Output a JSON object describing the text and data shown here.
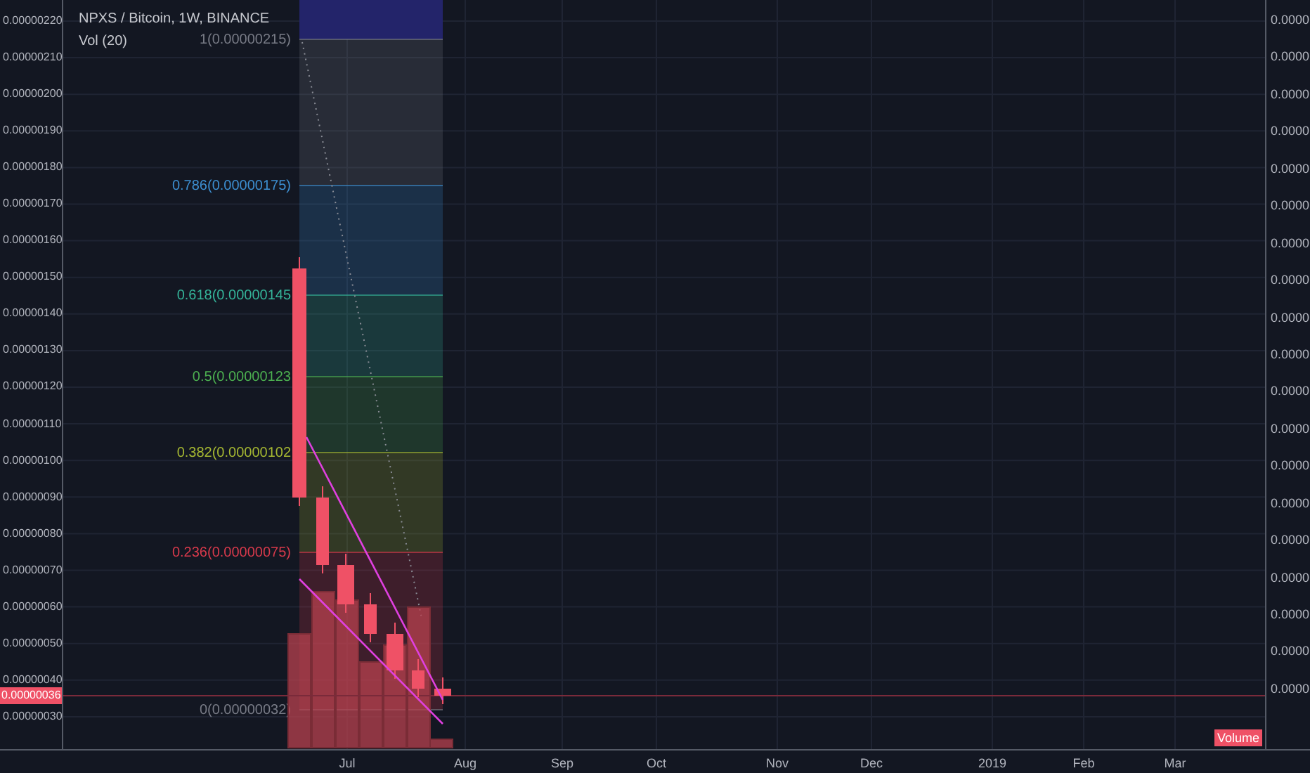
{
  "legend": {
    "symbol": "NPXS / Bitcoin, 1W, BINANCE",
    "indicator": "Vol (20)"
  },
  "price_axis": [
    "0.00000220",
    "0.00000210",
    "0.00000200",
    "0.00000190",
    "0.00000180",
    "0.00000170",
    "0.00000160",
    "0.00000150",
    "0.00000140",
    "0.00000130",
    "0.00000120",
    "0.00000110",
    "0.00000100",
    "0.00000090",
    "0.00000080",
    "0.00000070",
    "0.00000060",
    "0.00000050",
    "0.00000040",
    "0.00000030"
  ],
  "current_price": "0.00000036",
  "volume_axis": [
    "0.0000",
    "0.0000",
    "0.0000",
    "0.0000",
    "0.0000",
    "0.0000",
    "0.0000",
    "0.0000",
    "0.0000",
    "0.0000",
    "0.0000",
    "0.0000",
    "0.0000",
    "0.0000",
    "0.0000",
    "0.0000",
    "0.0000",
    "0.0000",
    "0.0000"
  ],
  "volume_badge": "Volume",
  "time_axis": [
    "Jul",
    "Aug",
    "Sep",
    "Oct",
    "Nov",
    "Dec",
    "2019",
    "Feb",
    "Mar"
  ],
  "fib_levels": [
    {
      "label": "1(0.00000215)",
      "color": "#787b86"
    },
    {
      "label": "0.786(0.00000175)",
      "color": "#3d8fd1"
    },
    {
      "label": "0.618(0.00000145",
      "color": "#35b59a"
    },
    {
      "label": "0.5(0.00000123",
      "color": "#4caf50"
    },
    {
      "label": "0.382(0.00000102",
      "color": "#a6b832"
    },
    {
      "label": "0.236(0.00000075)",
      "color": "#d93a4c"
    },
    {
      "label": "0(0.00000032)",
      "color": "#787b86"
    }
  ]
}
